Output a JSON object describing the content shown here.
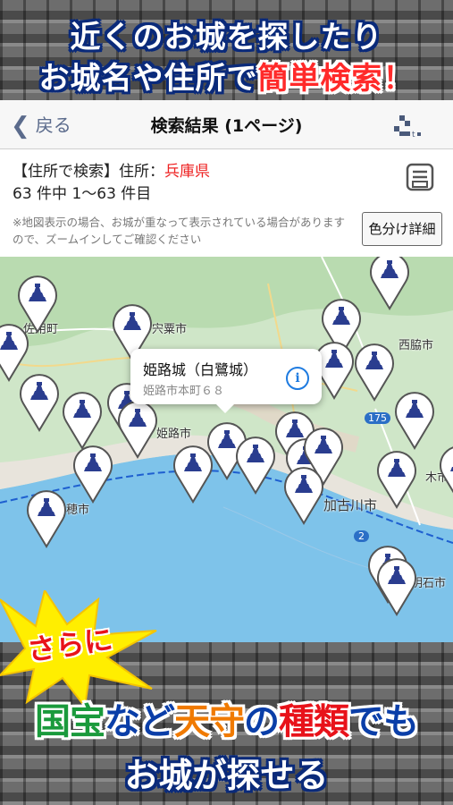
{
  "promo": {
    "line1": "近くのお城を探したり",
    "line2_prefix": "お城名や住所で",
    "line2_highlight": "簡単検索！",
    "burst": "さらに",
    "bottom1_a": "国宝",
    "bottom1_b": "など",
    "bottom1_c": "天守",
    "bottom1_d": "の",
    "bottom1_e": "種類",
    "bottom1_f": "でも",
    "bottom2": "お城が探せる"
  },
  "nav": {
    "back_label": "戻る",
    "title": "検索結果 (1ページ)"
  },
  "search": {
    "condition_prefix": "【住所で検索】住所：",
    "prefecture": "兵庫県",
    "count_text": "63 件中 1〜63 件目",
    "note": "※地図表示の場合、お城が重なって表示されている場合がありますので、ズームインしてご確認ください",
    "color_button": "色分け詳細"
  },
  "map": {
    "callout_title": "姫路城（白鷺城）",
    "callout_address": "姫路市本町６８",
    "labels": [
      "佐用町",
      "宍粟市",
      "西脇市",
      "姫路市",
      "加古川市",
      "木市",
      "穂市",
      "明石市",
      "175",
      "2"
    ]
  },
  "colors": {
    "accent_blue": "#0a2a7a",
    "highlight_red": "#e22",
    "link_blue": "#1e7be0"
  }
}
